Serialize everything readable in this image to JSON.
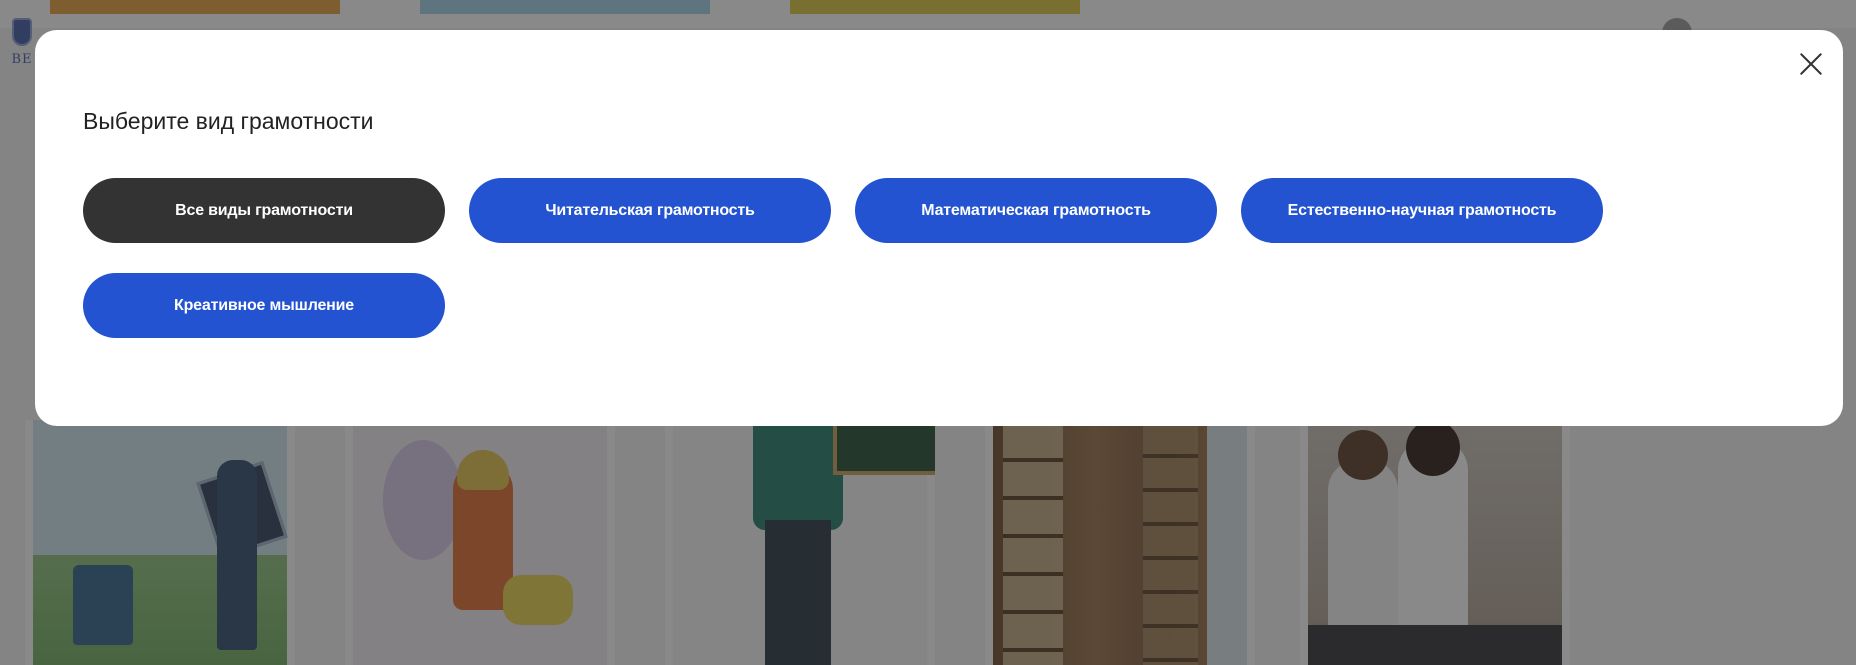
{
  "background": {
    "logo_text": "ВЕ",
    "cards": [
      {
        "kind": "eco"
      },
      {
        "kind": "kid"
      },
      {
        "kind": "teacher"
      },
      {
        "kind": "library"
      },
      {
        "kind": "students"
      }
    ]
  },
  "modal": {
    "title": "Выберите вид грамотности",
    "close_icon": "close-icon",
    "filters": [
      {
        "label": "Все виды грамотности",
        "active": true
      },
      {
        "label": "Читательская грамотность",
        "active": false
      },
      {
        "label": "Математическая грамотность",
        "active": false
      },
      {
        "label": "Естественно-научная грамотность",
        "active": false
      },
      {
        "label": "Креативное мышление",
        "active": false
      }
    ]
  },
  "colors": {
    "chip_active": "#333333",
    "chip_inactive": "#2353d1",
    "overlay": "rgba(40,40,40,0.55)"
  }
}
